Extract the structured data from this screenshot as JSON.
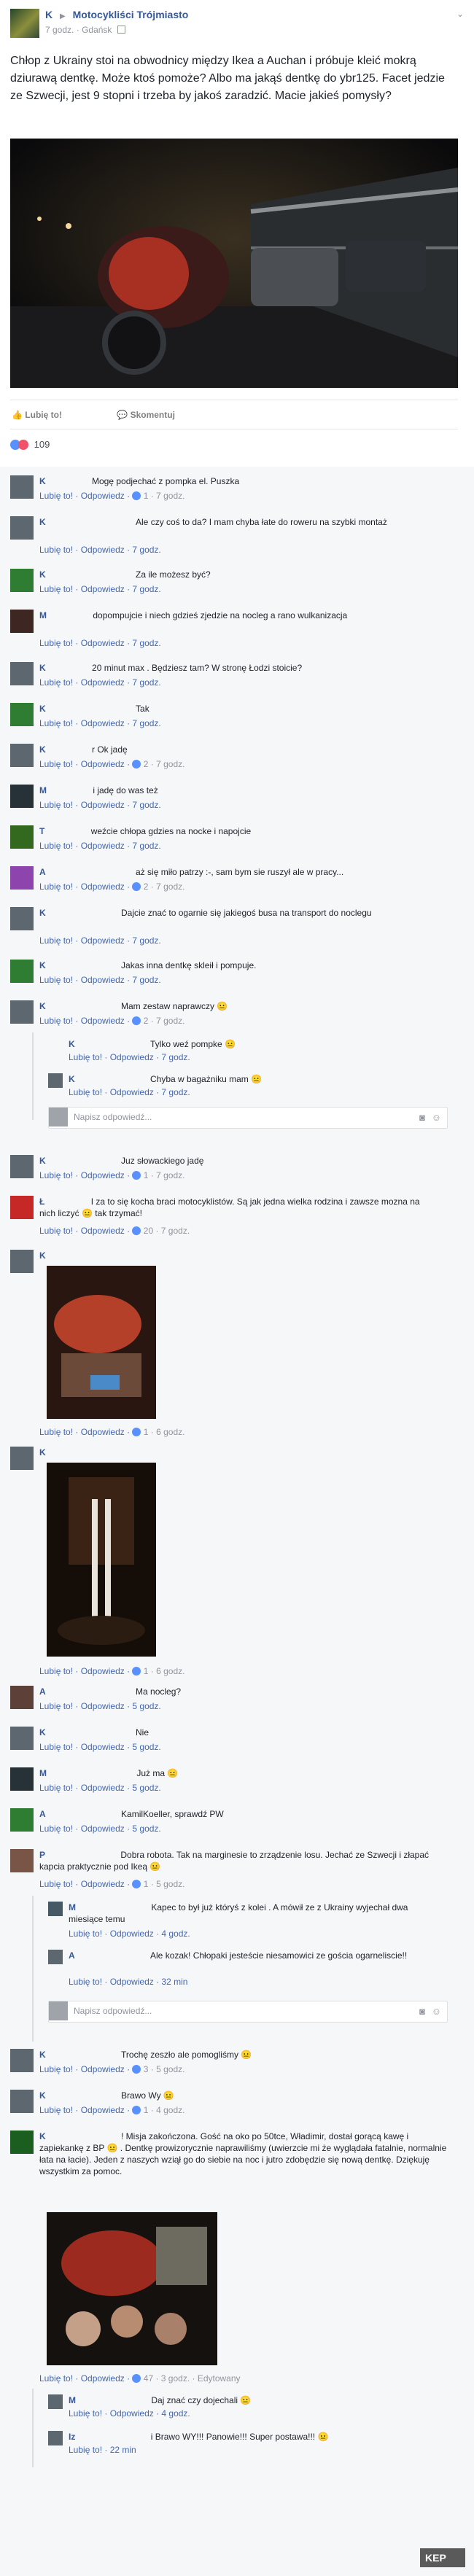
{
  "post": {
    "author": "K",
    "arrow": "▶",
    "group": "Motocykliści Trójmiasto",
    "time": "7 godz.",
    "location": "Gdańsk",
    "text": "Chłop z Ukrainy stoi na obwodnicy między Ikea a Auchan i próbuje kleić mokrą dziurawą dentkę. Może ktoś pomoże? Albo ma jakąś dentkę do ybr125. Facet jedzie ze Szwecji, jest 9 stopni i trzeba by jakoś zaradzić. Macie jakieś pomysły?",
    "like_label": "Lubię to!",
    "comment_label": "Skomentuj",
    "reaction_count": "109"
  },
  "comments": [
    {
      "name": "K",
      "text": "Mogę podjechać z pompka el. Puszka",
      "meta": "Lubię to! · Odpowiedz ·",
      "likes": "1",
      "time": "· 7 godz."
    },
    {
      "name": "K",
      "text": "Ale czy coś to da? I mam chyba łate do roweru na szybki montaż",
      "meta": "Lubię to! · Odpowiedz · 7 godz."
    },
    {
      "name": "K",
      "text": "Za ile możesz być?",
      "meta": "Lubię to! · Odpowiedz · 7 godz."
    },
    {
      "name": "M",
      "text": "dopompujcie i niech gdzieś zjedzie na nocleg a rano wulkanizacja",
      "meta": "Lubię to! · Odpowiedz · 7 godz."
    },
    {
      "name": "K",
      "text": "20 minut max . Będziesz tam? W stronę Łodzi stoicie?",
      "meta": "Lubię to! · Odpowiedz · 7 godz."
    },
    {
      "name": "K",
      "text": "Tak",
      "meta": "Lubię to! · Odpowiedz · 7 godz."
    },
    {
      "name": "K",
      "text": "r Ok jadę",
      "meta": "Lubię to! · Odpowiedz ·",
      "likes": "2",
      "time": "· 7 godz."
    },
    {
      "name": "M",
      "text": "i jadę do was też",
      "meta": "Lubię to! · Odpowiedz · 7 godz."
    },
    {
      "name": "T",
      "text": "weźcie chłopa gdzies na nocke i napojcie",
      "meta": "Lubię to! · Odpowiedz · 7 godz."
    },
    {
      "name": "A",
      "text": "aż się miło patrzy :-, sam bym sie ruszył ale w pracy...",
      "meta": "Lubię to! · Odpowiedz ·",
      "likes": "2",
      "time": "· 7 godz."
    },
    {
      "name": "K",
      "text": "Dajcie znać to ogarnie się jakiegoś busa na transport do noclegu",
      "meta": "Lubię to! · Odpowiedz · 7 godz."
    },
    {
      "name": "K",
      "text": "Jakas inna dentkę skleił i pompuje.",
      "meta": "Lubię to! · Odpowiedz · 7 godz."
    },
    {
      "name": "K",
      "text": "Mam zestaw naprawczy 😐",
      "meta": "Lubię to! · Odpowiedz ·",
      "likes": "2",
      "time": "· 7 godz."
    },
    {
      "name": "K",
      "text": "Tylko weź pompke 😐",
      "meta": "Lubię to! · Odpowiedz · 7 godz."
    },
    {
      "name": "K",
      "text": "Chyba w bagażniku mam 😐",
      "meta": "Lubię to! · Odpowiedz · 7 godz."
    },
    {
      "name": "K",
      "text": "Juz słowackiego jadę",
      "meta": "Lubię to! · Odpowiedz ·",
      "likes": "1",
      "time": "· 7 godz."
    },
    {
      "name": "Ł",
      "text": "I za to się kocha braci motocyklistów. Są jak jedna wielka rodzina i zawsze mozna na nich liczyć 😐 tak trzymać!",
      "meta": "Lubię to! · Odpowiedz ·",
      "likes": "20",
      "time": "· 7 godz."
    },
    {
      "name": "K",
      "text": "",
      "meta": "Lubię to! · Odpowiedz ·",
      "likes": "1",
      "time": "· 6 godz."
    },
    {
      "name": "K",
      "text": "",
      "meta": "Lubię to! · Odpowiedz ·",
      "likes": "1",
      "time": "· 6 godz."
    },
    {
      "name": "A",
      "text": "Ma nocleg?",
      "meta": "Lubię to! · Odpowiedz · 5 godz."
    },
    {
      "name": "K",
      "text": "Nie",
      "meta": "Lubię to! · Odpowiedz · 5 godz."
    },
    {
      "name": "M",
      "text": "Już ma 😐",
      "meta": "Lubię to! · Odpowiedz · 5 godz."
    },
    {
      "name": "A",
      "text": "KamilKoeller, sprawdź PW",
      "meta": "Lubię to! · Odpowiedz · 5 godz."
    },
    {
      "name": "P",
      "text": "Dobra robota. Tak na marginesie to zrządzenie losu. Jechać ze Szwecji i złapać kapcia praktycznie pod Ikeą 😐",
      "meta": "Lubię to! · Odpowiedz ·",
      "likes": "1",
      "time": "· 5 godz."
    },
    {
      "name": "M",
      "text": "Kapec to był już któryś z kolei . A mówił ze z Ukrainy wyjechał dwa miesiące temu",
      "meta": "Lubię to! · Odpowiedz · 4 godz."
    },
    {
      "name": "A",
      "text": "Ale kozak! Chłopaki jesteście niesamowici ze gościa ogarneliscie!!",
      "meta": "Lubię to! · Odpowiedz · 32 min"
    },
    {
      "name": "K",
      "text": "Trochę zeszło ale pomogliśmy 😐",
      "meta": "Lubię to! · Odpowiedz ·",
      "likes": "3",
      "time": "· 5 godz."
    },
    {
      "name": "K",
      "text": "Brawo Wy 😐",
      "meta": "Lubię to! · Odpowiedz ·",
      "likes": "1",
      "time": "· 4 godz."
    },
    {
      "name": "K",
      "text": "! Misja zakończona. Gość na oko po 50tce, Władimir, dostał gorącą kawę i zapiekankę z BP 😐 . Dentkę prowizorycznie naprawiliśmy (uwierzcie mi że wyglądała fatalnie, normalnie łata na łacie). Jeden z naszych wziął go do siebie na noc i jutro zdobędzie się nową dentkę. Dziękuję wszystkim za pomoc.",
      "meta": "Lubię to! · Odpowiedz ·",
      "likes": "47",
      "time": "· 3 godz. · Edytowany"
    },
    {
      "name": "M",
      "text": "Daj znać czy dojechali 😐",
      "meta": "Lubię to! · Odpowiedz · 4 godz."
    },
    {
      "name": "Iz",
      "text": "i Brawo WY!!! Panowie!!! Super postawa!!! 😐",
      "meta": "Lubię to! · 22 min"
    }
  ],
  "reply_placeholder": "Napisz odpowiedź...",
  "watermark": "KEP"
}
